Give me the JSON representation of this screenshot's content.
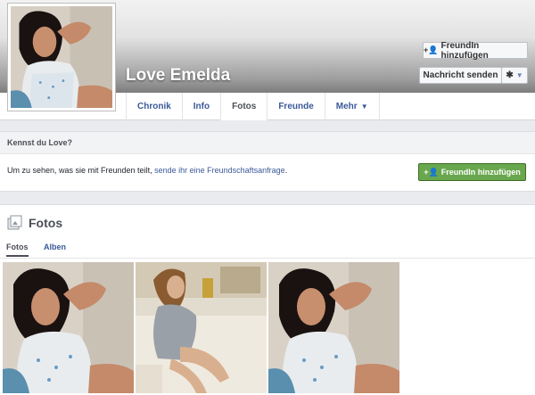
{
  "profile": {
    "name": "Love Emelda"
  },
  "header_buttons": {
    "add_friend": "FreundIn hinzufügen",
    "message": "Nachricht senden"
  },
  "tabs": [
    {
      "label": "Chronik"
    },
    {
      "label": "Info"
    },
    {
      "label": "Fotos"
    },
    {
      "label": "Freunde"
    },
    {
      "label": "Mehr"
    }
  ],
  "know": {
    "title": "Kennst du Love?",
    "text": "Um zu sehen, was sie mit Freunden teilt,",
    "link": "sende ihr eine Freundschaftsanfrage",
    "period": ".",
    "button": "FreundIn hinzufügen"
  },
  "photos": {
    "title": "Fotos",
    "tabs": [
      "Fotos",
      "Alben"
    ]
  },
  "icons": {
    "add_friend": "add-friend-icon",
    "gear": "gear-icon",
    "caret": "chevron-down-icon",
    "photos": "photos-icon"
  },
  "colors": {
    "link": "#3b5998",
    "green_button": "#69a74e"
  }
}
